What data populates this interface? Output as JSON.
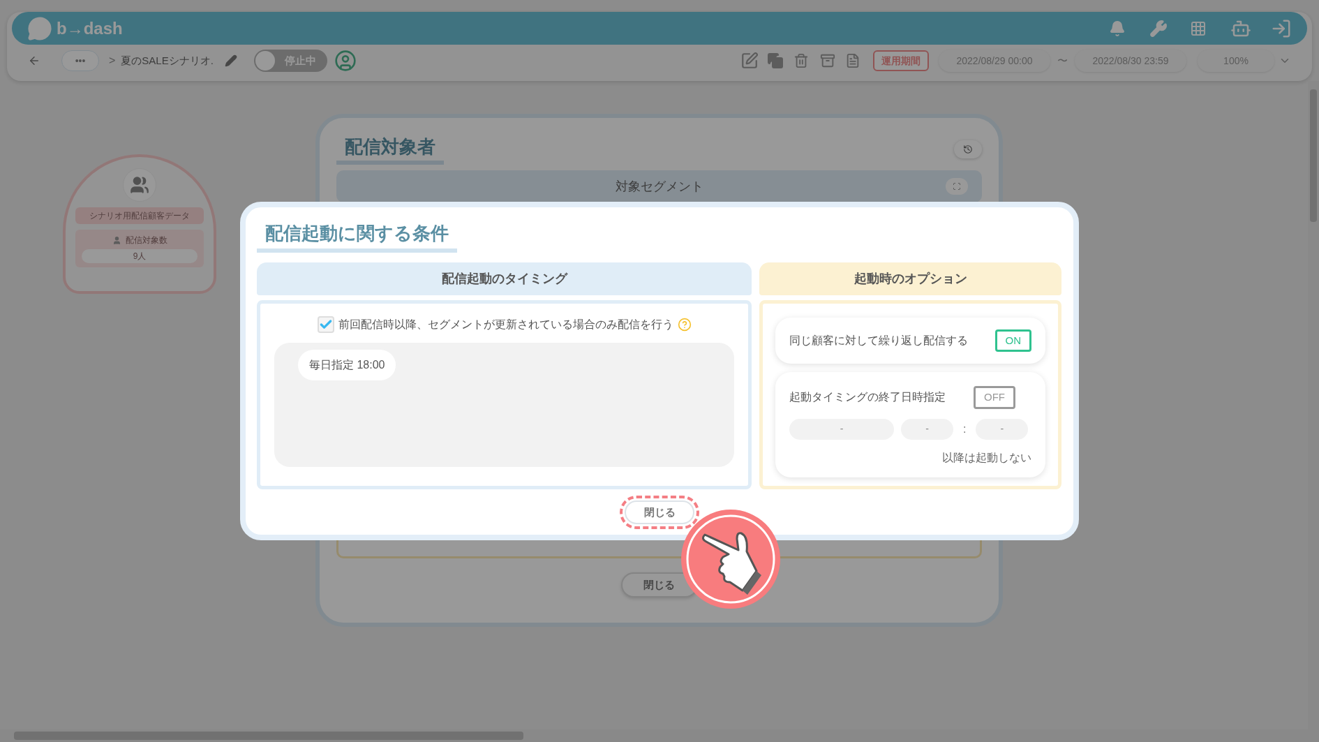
{
  "header": {
    "logo": "b→dash"
  },
  "toolbar": {
    "more": "•••",
    "separator": ">",
    "scenario_name": "夏のSALEシナリオ.",
    "status": {
      "label": "停止中",
      "on": false
    },
    "period_button": "運用期間",
    "start": "2022/08/29 00:00",
    "tilde": "〜",
    "end": "2022/08/30 23:59",
    "zoom": "100%"
  },
  "node": {
    "title": "シナリオ用配信顧客データ",
    "count_label": "配信対象数",
    "count": "9人"
  },
  "background_dialog": {
    "title": "配信対象者",
    "section": "対象セグメント",
    "close": "閉じる"
  },
  "modal": {
    "title": "配信起動に関する条件",
    "timing": {
      "header": "配信起動のタイミング",
      "checkbox": {
        "label": "前回配信時以降、セグメントが更新されている場合のみ配信を行う",
        "checked": true
      },
      "schedule": "毎日指定 18:00"
    },
    "options": {
      "header": "起動時のオプション",
      "items": [
        {
          "kind": "toggle",
          "label": "同じ顧客に対して繰り返し配信する",
          "on": true,
          "toggle_text": "ON"
        },
        {
          "kind": "end_date",
          "label": "起動タイミングの終了日時指定",
          "on": false,
          "toggle_text": "OFF",
          "fields": [
            "-",
            "-",
            "-"
          ],
          "separator": ":",
          "note": "以降は起動しない"
        }
      ]
    },
    "close_button": "閉じる"
  }
}
